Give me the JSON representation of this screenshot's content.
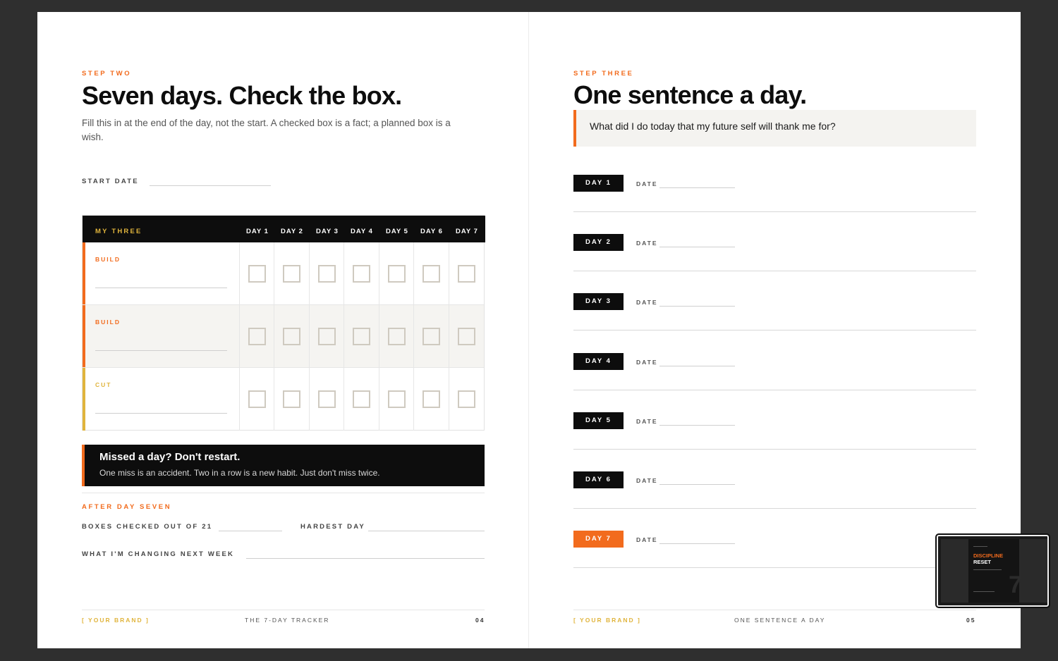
{
  "colors": {
    "accent": "#f26b1d",
    "gold": "#e0b43c",
    "ink": "#0d0d0d",
    "page": "#ffffff",
    "backdrop": "#2f2f2f"
  },
  "left": {
    "eyebrow": "STEP TWO",
    "title": "Seven days. Check the box.",
    "lede": "Fill this in at the end of the day, not the start. A checked box is a fact; a planned box is a wish.",
    "start_date_label": "START DATE",
    "tracker": {
      "header": "MY THREE",
      "days": [
        "DAY 1",
        "DAY 2",
        "DAY 3",
        "DAY 4",
        "DAY 5",
        "DAY 6",
        "DAY 7"
      ],
      "rows": [
        {
          "label": "BUILD",
          "color": "#f26b1d"
        },
        {
          "label": "BUILD",
          "color": "#f26b1d"
        },
        {
          "label": "CUT",
          "color": "#e0b43c"
        }
      ]
    },
    "callout": {
      "title": "Missed a day? Don't restart.",
      "body": "One miss is an accident. Two in a row is a new habit. Just don't miss twice."
    },
    "after": {
      "heading": "AFTER DAY SEVEN",
      "boxes_label": "BOXES CHECKED OUT OF 21",
      "hardest_label": "HARDEST DAY",
      "changing_label": "WHAT I'M CHANGING NEXT WEEK"
    },
    "footer": {
      "brand": "[ YOUR BRAND ]",
      "section": "THE 7-DAY TRACKER",
      "page": "04"
    }
  },
  "right": {
    "eyebrow": "STEP THREE",
    "title": "One sentence a day.",
    "prompt": "What did I do today that my future self will thank me for?",
    "date_label": "DATE",
    "entries": [
      {
        "day": "DAY 1",
        "highlight": false
      },
      {
        "day": "DAY 2",
        "highlight": false
      },
      {
        "day": "DAY 3",
        "highlight": false
      },
      {
        "day": "DAY 4",
        "highlight": false
      },
      {
        "day": "DAY 5",
        "highlight": false
      },
      {
        "day": "DAY 6",
        "highlight": false
      },
      {
        "day": "DAY 7",
        "highlight": true
      }
    ],
    "footer": {
      "brand": "[ YOUR BRAND ]",
      "section": "ONE SENTENCE A DAY",
      "page": "05"
    }
  },
  "thumbnail": {
    "line1": "DISCIPLINE",
    "line2": "RESET",
    "number": "7"
  }
}
